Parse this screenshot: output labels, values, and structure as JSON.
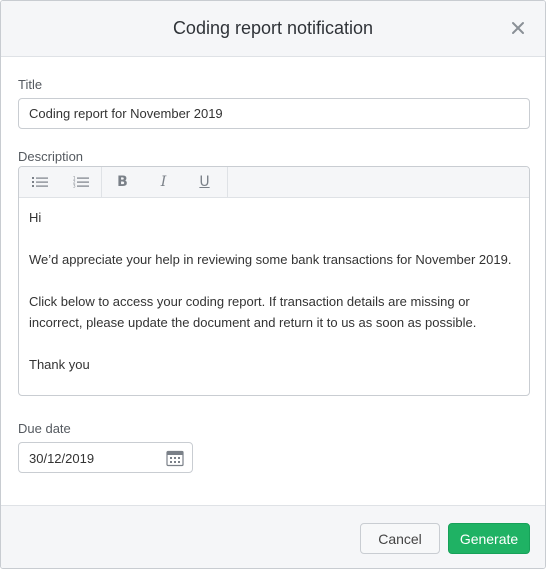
{
  "modal": {
    "title": "Coding report notification"
  },
  "form": {
    "title_label": "Title",
    "title_value": "Coding report for November 2019",
    "description_label": "Description",
    "description_paragraphs": [
      "Hi",
      "We’d appreciate your help in reviewing some bank transactions for November 2019.",
      "Click below to access your coding report. If transaction details are missing or incorrect, please update the document and return it to us as soon as possible.",
      "Thank you"
    ],
    "due_date_label": "Due date",
    "due_date_value": "30/12/2019"
  },
  "toolbar": {
    "bold_glyph": "B",
    "italic_glyph": "I",
    "underline_glyph": "U"
  },
  "footer": {
    "cancel_label": "Cancel",
    "generate_label": "Generate"
  },
  "colors": {
    "primary": "#1fb264",
    "header_bg": "#f5f6f8"
  }
}
